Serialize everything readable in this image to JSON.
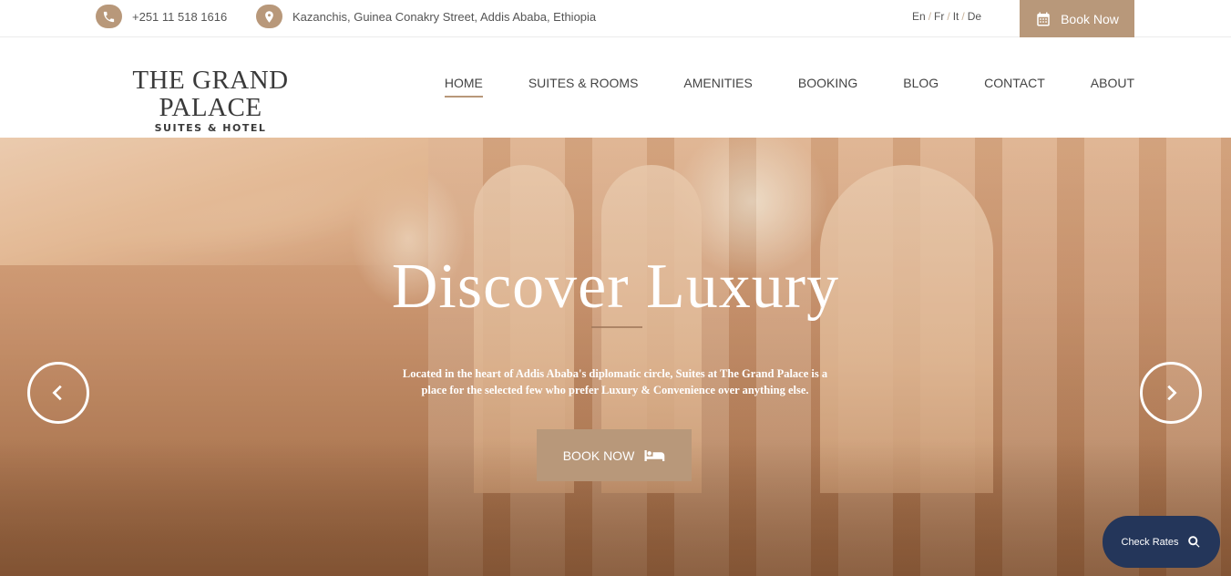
{
  "topbar": {
    "phone": "+251 11 518 1616",
    "address": "Kazanchis, Guinea Conakry Street, Addis Ababa, Ethiopia",
    "languages": [
      "En",
      "Fr",
      "It",
      "De"
    ],
    "language_separator": "/",
    "book_label": "Book Now",
    "icons": {
      "phone": "phone-icon",
      "address": "location-pin-icon",
      "book": "calendar-icon"
    }
  },
  "header": {
    "logo_line1": "THE GRAND PALACE",
    "logo_line2": "SUITES & HOTEL",
    "nav": [
      {
        "label": "HOME",
        "active": true
      },
      {
        "label": "SUITES & ROOMS",
        "active": false
      },
      {
        "label": "AMENITIES",
        "active": false
      },
      {
        "label": "BOOKING",
        "active": false
      },
      {
        "label": "BLOG",
        "active": false
      },
      {
        "label": "CONTACT",
        "active": false
      },
      {
        "label": "ABOUT",
        "active": false
      }
    ]
  },
  "hero": {
    "title": "Discover Luxury",
    "text": "Located in the heart of Addis Ababa's diplomatic circle, Suites at The Grand Palace is a place for the selected few who prefer Luxury & Convenience over anything else.",
    "button_label": "BOOK NOW",
    "icons": {
      "button": "bed-icon",
      "prev": "chevron-left-icon",
      "next": "chevron-right-icon"
    }
  },
  "widget": {
    "check_rates_label": "Check Rates",
    "icon": "search-icon"
  },
  "colors": {
    "accent": "#b8987a",
    "widget_bg": "#24365a",
    "text": "#444444"
  }
}
